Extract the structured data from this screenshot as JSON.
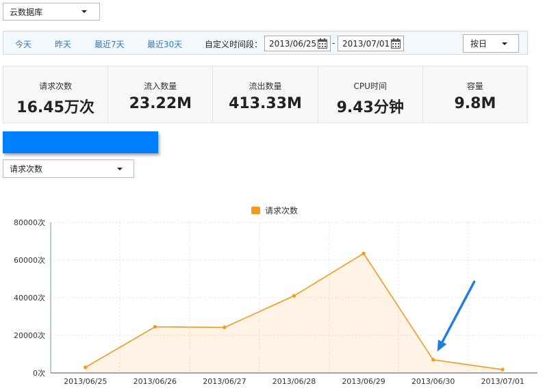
{
  "database_select": {
    "value": "云数据库"
  },
  "toolbar": {
    "ranges": [
      "今天",
      "昨天",
      "最近7天",
      "最近30天"
    ],
    "custom_label": "自定义时间段：",
    "start_date": "2013/06/25",
    "date_separator": "-",
    "end_date": "2013/07/01",
    "group_by": "按日"
  },
  "stats": [
    {
      "label": "请求次数",
      "value": "16.45万次"
    },
    {
      "label": "流入数量",
      "value": "23.22M"
    },
    {
      "label": "流出数量",
      "value": "413.33M"
    },
    {
      "label": "CPU时间",
      "value": "9.43分钟"
    },
    {
      "label": "容量",
      "value": "9.8M"
    }
  ],
  "metric_select": {
    "value": "请求次数"
  },
  "colors": {
    "accent": "#0080ff",
    "series": "#f39a1e",
    "link": "#2a7bc3",
    "arrow": "#1f7fe0"
  },
  "chart_data": {
    "type": "area",
    "title": "",
    "xlabel": "",
    "ylabel": "",
    "legend": {
      "position": "top",
      "entries": [
        "请求次数"
      ]
    },
    "categories": [
      "2013/06/25",
      "2013/06/26",
      "2013/06/27",
      "2013/06/28",
      "2013/06/29",
      "2013/06/30",
      "2013/07/01"
    ],
    "series": [
      {
        "name": "请求次数",
        "values": [
          3000,
          24500,
          24200,
          41000,
          63500,
          7000,
          1800
        ]
      }
    ],
    "ylim": [
      0,
      80000
    ],
    "yticks": [
      0,
      20000,
      40000,
      60000,
      80000
    ],
    "ytick_labels": [
      "0次",
      "20000次",
      "40000次",
      "60000次",
      "80000次"
    ],
    "grid": true,
    "annotation": {
      "type": "arrow",
      "target_category": "2013/06/30"
    }
  }
}
